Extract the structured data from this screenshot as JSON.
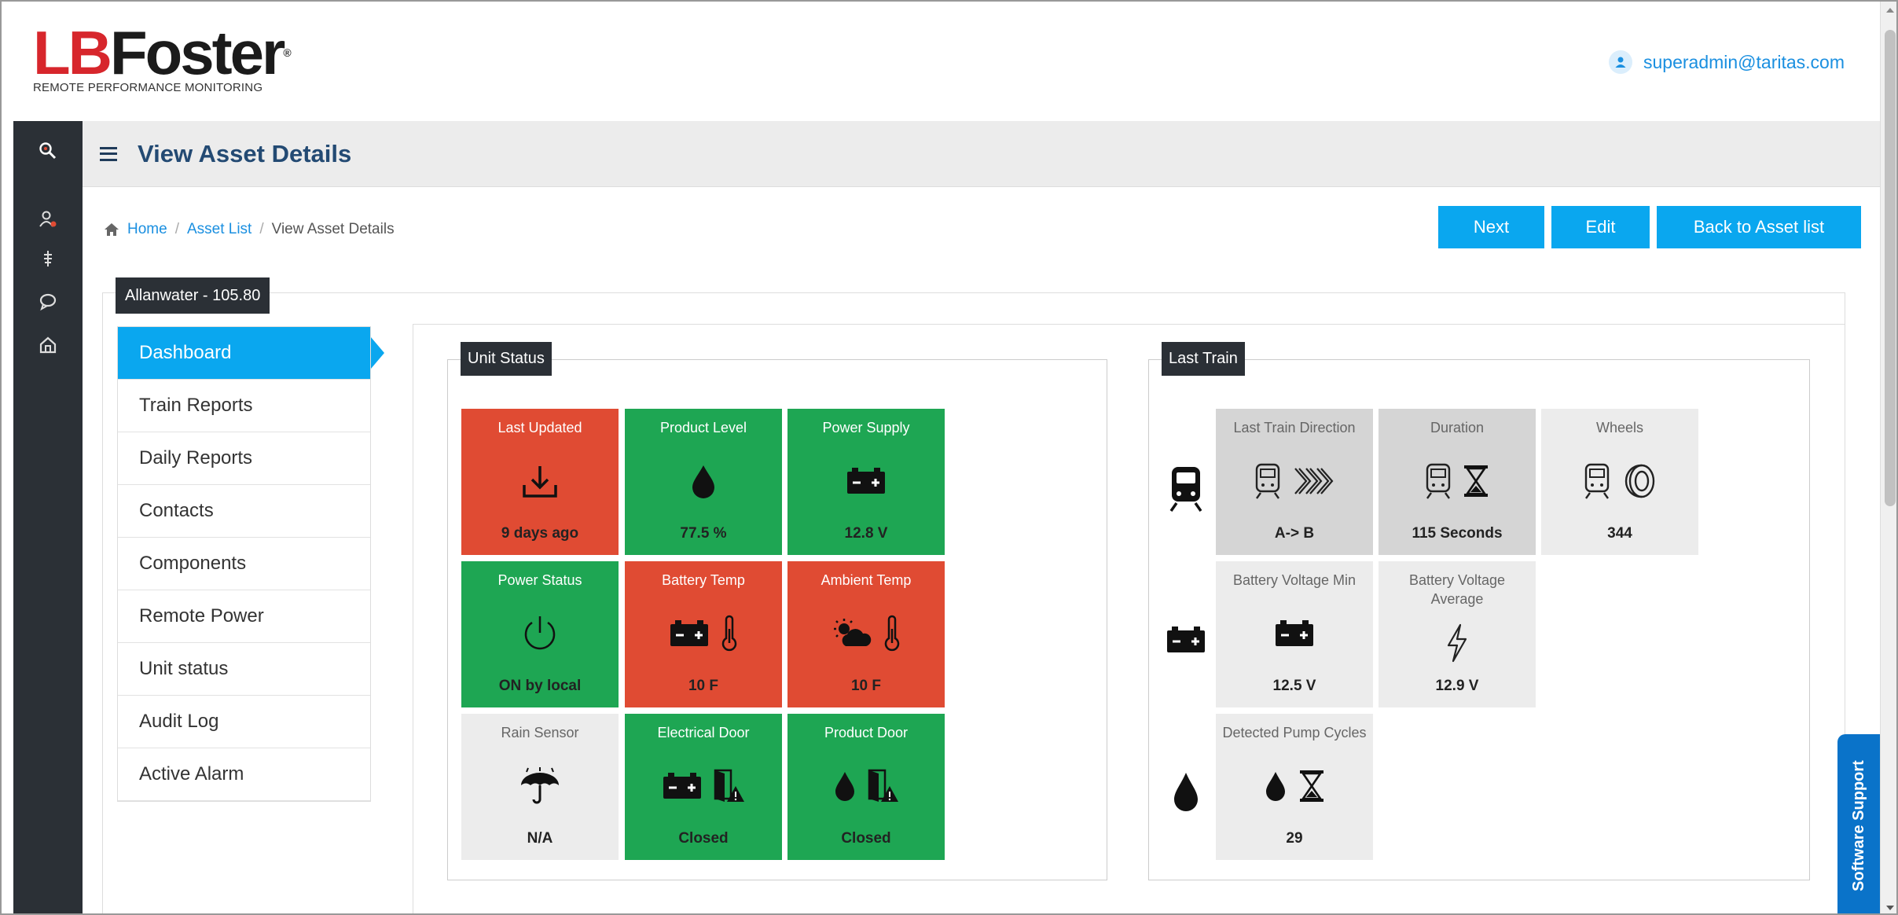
{
  "header": {
    "logo_lb": "LB",
    "logo_foster": "Foster",
    "logo_reg": "®",
    "logo_subtitle": "REMOTE PERFORMANCE MONITORING",
    "user_email": "superadmin@taritas.com"
  },
  "titlebar": {
    "title": "View Asset Details"
  },
  "breadcrumb": {
    "home": "Home",
    "asset_list": "Asset List",
    "current": "View Asset Details",
    "sep": "/"
  },
  "buttons": {
    "next": "Next",
    "edit": "Edit",
    "back": "Back to Asset list"
  },
  "asset": {
    "name": "Allanwater - 105.80"
  },
  "sidenav": {
    "items": [
      {
        "label": "Dashboard",
        "active": true
      },
      {
        "label": "Train Reports"
      },
      {
        "label": "Daily Reports"
      },
      {
        "label": "Contacts"
      },
      {
        "label": "Components"
      },
      {
        "label": "Remote Power"
      },
      {
        "label": "Unit status"
      },
      {
        "label": "Audit Log"
      },
      {
        "label": "Active Alarm"
      }
    ]
  },
  "unit_status": {
    "heading": "Unit Status",
    "tiles": [
      {
        "title": "Last Updated",
        "value": "9 days ago",
        "status": "red",
        "icon": "download-icon"
      },
      {
        "title": "Product Level",
        "value": "77.5 %",
        "status": "green",
        "icon": "droplet-icon"
      },
      {
        "title": "Power Supply",
        "value": "12.8 V",
        "status": "green",
        "icon": "battery-icon"
      },
      {
        "title": "Power Status",
        "value": "ON by local",
        "status": "green",
        "icon": "power-icon"
      },
      {
        "title": "Battery Temp",
        "value": "10 F",
        "status": "red",
        "icon": "battery-thermometer-icon"
      },
      {
        "title": "Ambient Temp",
        "value": "10 F",
        "status": "red",
        "icon": "weather-thermometer-icon"
      },
      {
        "title": "Rain Sensor",
        "value": "N/A",
        "status": "grey",
        "icon": "umbrella-icon"
      },
      {
        "title": "Electrical Door",
        "value": "Closed",
        "status": "green",
        "icon": "battery-door-icon"
      },
      {
        "title": "Product Door",
        "value": "Closed",
        "status": "green",
        "icon": "droplet-door-icon"
      }
    ]
  },
  "last_train": {
    "heading": "Last Train",
    "tiles": [
      {
        "title": "Last Train Direction",
        "value": "A-> B",
        "icon": "train-direction-icon"
      },
      {
        "title": "Duration",
        "value": "115 Seconds",
        "icon": "train-hourglass-icon"
      },
      {
        "title": "Wheels",
        "value": "344",
        "icon": "train-wheel-icon"
      },
      {
        "title": "Battery Voltage Min",
        "value": "12.5 V",
        "icon": "battery-icon"
      },
      {
        "title": "Battery Voltage Average",
        "value": "12.9 V",
        "icon": "lightning-icon"
      },
      {
        "title": "Detected Pump Cycles",
        "value": "29",
        "icon": "droplet-hourglass-icon"
      }
    ]
  },
  "support": {
    "label": "Software Support"
  },
  "colors": {
    "accent": "#0aa7ef",
    "red": "#e04b33",
    "green": "#1ea653",
    "dark": "#2b3036",
    "title": "#234a73"
  }
}
